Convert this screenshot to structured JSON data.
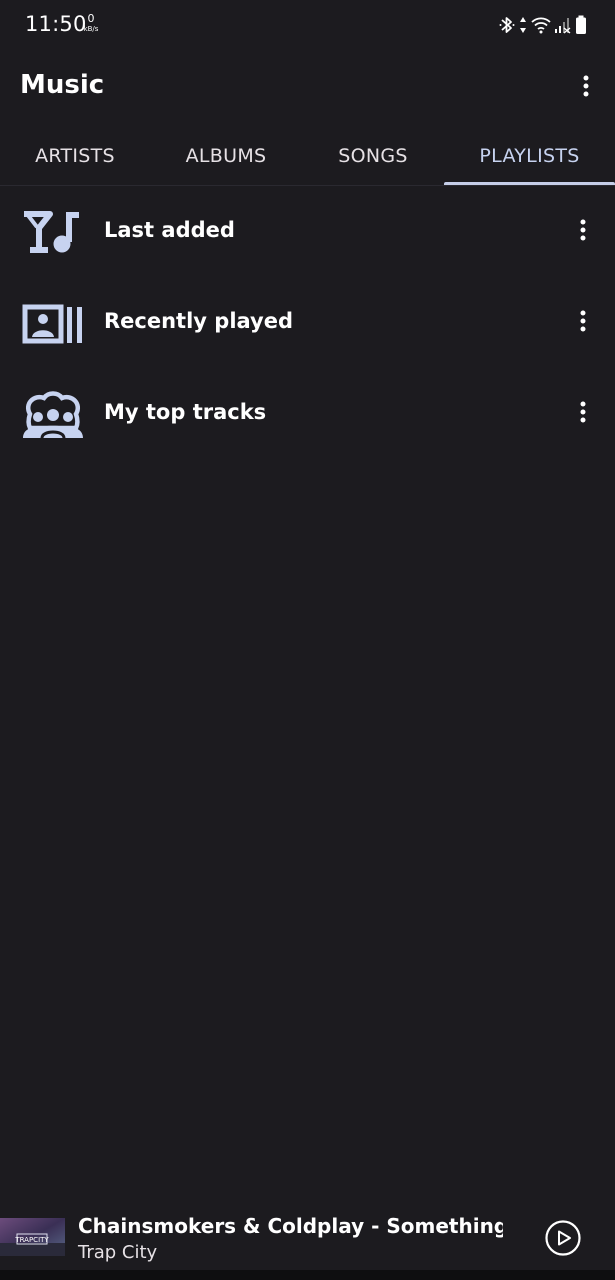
{
  "status_bar": {
    "time": "11:50",
    "net_speed_value": "0",
    "net_speed_unit": "kB/s",
    "icons": [
      "bluetooth-icon",
      "data-arrows-icon",
      "wifi-icon",
      "signal-icon",
      "battery-icon"
    ]
  },
  "app_bar": {
    "title": "Music",
    "overflow_icon": "more-vert-icon"
  },
  "tabs": [
    {
      "label": "ARTISTS",
      "active": false
    },
    {
      "label": "ALBUMS",
      "active": false
    },
    {
      "label": "SONGS",
      "active": false
    },
    {
      "label": "PLAYLISTS",
      "active": true
    }
  ],
  "playlists": [
    {
      "label": "Last added",
      "icon": "playlist-add-music-icon"
    },
    {
      "label": "Recently played",
      "icon": "recent-history-icon"
    },
    {
      "label": "My top tracks",
      "icon": "group-icon"
    }
  ],
  "now_playing": {
    "title": "Chainsmokers & Coldplay - Something Just Like This",
    "artist": "Trap City",
    "play_icon": "play-circle-icon",
    "album_art_text": "TRAPCITY"
  },
  "colors": {
    "background": "#1c1b1f",
    "accent": "#c5cde8",
    "icon_tint": "#c7d3f0",
    "text": "#ffffff"
  }
}
